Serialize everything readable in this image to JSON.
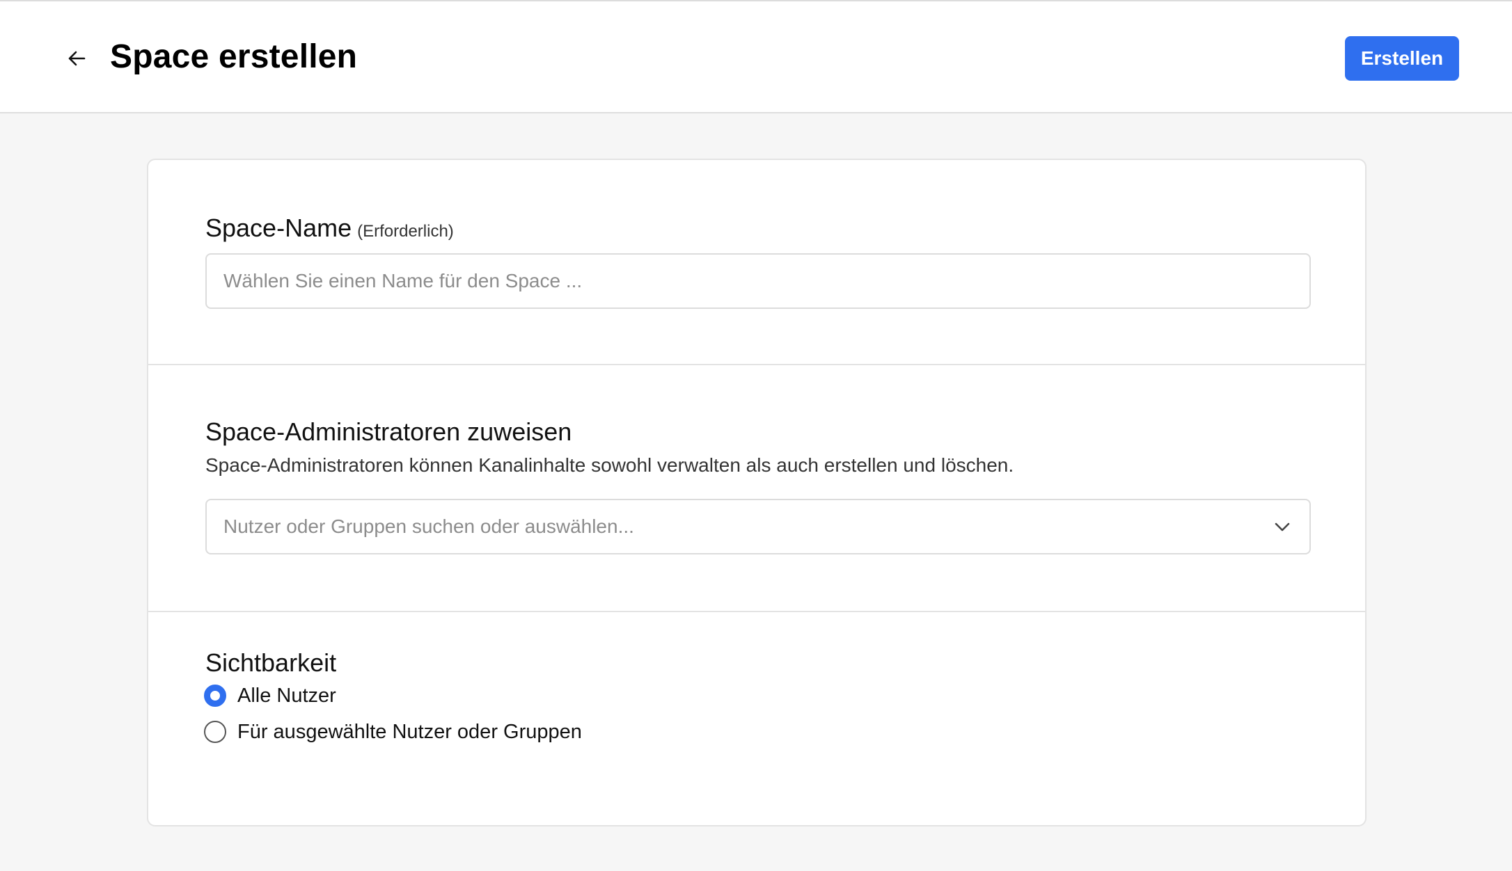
{
  "header": {
    "title": "Space erstellen",
    "create_label": "Erstellen",
    "back_icon": "arrow-left-icon"
  },
  "name_section": {
    "title": "Space-Name",
    "required_hint": "(Erforderlich)",
    "input_placeholder": "Wählen Sie einen Name für den Space ...",
    "input_value": ""
  },
  "admins_section": {
    "title": "Space-Administratoren zuweisen",
    "description": "Space-Administratoren können Kanalinhalte sowohl verwalten als auch erstellen und löschen.",
    "select_placeholder": "Nutzer oder Gruppen suchen oder auswählen...",
    "select_icon": "chevron-down-icon"
  },
  "visibility_section": {
    "title": "Sichtbarkeit",
    "options": [
      {
        "label": "Alle Nutzer",
        "checked": true
      },
      {
        "label": "Für ausgewählte Nutzer oder Gruppen",
        "checked": false
      }
    ]
  },
  "colors": {
    "accent": "#2f6fef",
    "background": "#f6f6f6",
    "card": "#ffffff",
    "border": "#e3e3e3"
  }
}
